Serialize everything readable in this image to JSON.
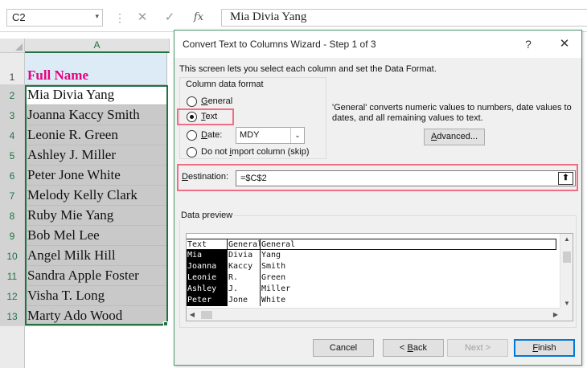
{
  "formula_bar": {
    "name_box": "C2",
    "dropdown_glyph": "▾",
    "separator_glyph": "⋮",
    "cancel_glyph": "✕",
    "enter_glyph": "✓",
    "fx_label": "fx",
    "value": "Mia Divia Yang"
  },
  "sheet": {
    "column_header": "A",
    "rows": [
      {
        "num": "1",
        "value": "Full Name"
      },
      {
        "num": "2",
        "value": "Mia Divia Yang"
      },
      {
        "num": "3",
        "value": "Joanna Kaccy Smith"
      },
      {
        "num": "4",
        "value": "Leonie R. Green"
      },
      {
        "num": "5",
        "value": "Ashley J. Miller"
      },
      {
        "num": "6",
        "value": "Peter Jone White"
      },
      {
        "num": "7",
        "value": "Melody Kelly Clark"
      },
      {
        "num": "8",
        "value": "Ruby Mie Yang"
      },
      {
        "num": "9",
        "value": "Bob Mel Lee"
      },
      {
        "num": "10",
        "value": "Angel Milk Hill"
      },
      {
        "num": "11",
        "value": "Sandra Apple Foster"
      },
      {
        "num": "12",
        "value": "Visha T. Long"
      },
      {
        "num": "13",
        "value": "Marty Ado Wood"
      }
    ],
    "colors": {
      "header_fill": "#ddebf7",
      "header_text": "#e6007e",
      "selection": "#217346"
    }
  },
  "dialog": {
    "title": "Convert Text to Columns Wizard - Step 1 of 3",
    "help_glyph": "?",
    "close_glyph": "✕",
    "description": "This screen lets you select each column and set the Data Format.",
    "format_group_label": "Column data format",
    "options": {
      "general": {
        "before": "",
        "mnemonic": "G",
        "after": "eneral",
        "checked": false
      },
      "text": {
        "before": "",
        "mnemonic": "T",
        "after": "ext",
        "checked": true
      },
      "date": {
        "before": "",
        "mnemonic": "D",
        "after": "ate:",
        "checked": false
      },
      "skip": {
        "before": "Do not ",
        "mnemonic": "i",
        "after": "mport column (skip)",
        "checked": false
      }
    },
    "date_format": "MDY",
    "date_arrow_glyph": "⌄",
    "general_note": "'General' converts numeric values to numbers, date values to dates, and all remaining values to text.",
    "advanced": {
      "mnemonic": "A",
      "after": "dvanced..."
    },
    "destination": {
      "mnemonic": "D",
      "after": "estination:",
      "value": "=$C$2",
      "collapse_glyph": "⬆"
    },
    "preview_label": "Data preview",
    "preview": {
      "headers": [
        "Text",
        "General",
        "General"
      ],
      "col0": [
        "Mia",
        "Joanna",
        "Leonie",
        "Ashley",
        "Peter"
      ],
      "col1": [
        "Divia",
        "Kaccy",
        "R.",
        "J.",
        "Jone"
      ],
      "col2": [
        "Yang",
        "Smith",
        "Green",
        "Miller",
        "White"
      ]
    },
    "scroll_glyphs": {
      "up": "▲",
      "down": "▼",
      "left": "◀",
      "right": "▶"
    },
    "buttons": {
      "cancel": "Cancel",
      "back": {
        "before": "< ",
        "mnemonic": "B",
        "after": "ack"
      },
      "next": "Next >",
      "finish": {
        "before": "",
        "mnemonic": "F",
        "after": "inish"
      }
    },
    "colors": {
      "highlight": "#f06e85",
      "default_button": "#0078d7"
    }
  }
}
